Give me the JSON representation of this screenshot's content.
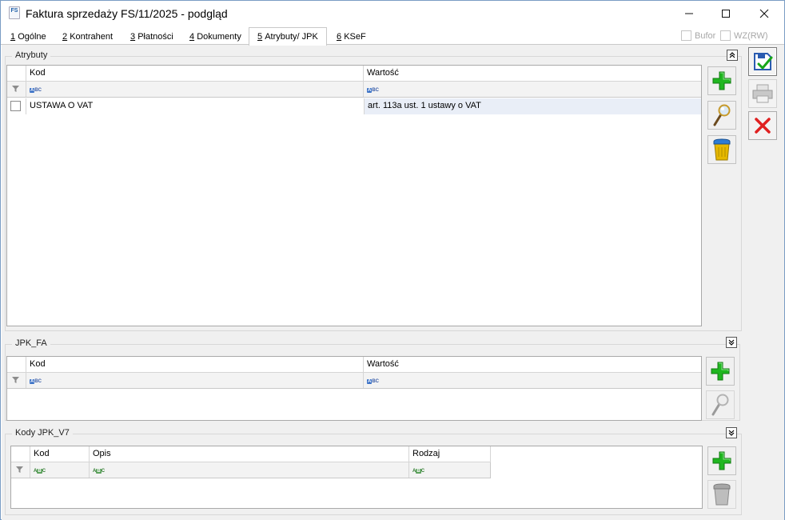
{
  "window": {
    "title": "Faktura sprzedaży FS/11/2025 - podgląd",
    "app_icon_text": "FS"
  },
  "tabs": [
    {
      "key": "1",
      "label": "Ogólne"
    },
    {
      "key": "2",
      "label": "Kontrahent"
    },
    {
      "key": "3",
      "label": "Płatności"
    },
    {
      "key": "4",
      "label": "Dokumenty"
    },
    {
      "key": "5",
      "label": "Atrybuty/ JPK"
    },
    {
      "key": "6",
      "label": "KSeF"
    }
  ],
  "header_checks": {
    "bufor": "Bufor",
    "wz": "WZ(RW)"
  },
  "atrybuty": {
    "legend": "Atrybuty",
    "columns": [
      "Kod",
      "Wartość"
    ],
    "filter_text": "ABC",
    "rows": [
      {
        "kod": "USTAWA O VAT",
        "wartosc": "art. 113a ust. 1 ustawy o VAT"
      }
    ]
  },
  "jpk_fa": {
    "legend": "JPK_FA",
    "columns": [
      "Kod",
      "Wartość"
    ],
    "filter_text": "ABC"
  },
  "kody_jpk_v7": {
    "legend": "Kody JPK_V7",
    "columns": [
      "Kod",
      "Opis",
      "Rodzaj"
    ],
    "filter_text": "ABC"
  },
  "colors": {
    "accent": "#1f5fa8",
    "plus_green": "#22b322",
    "cancel_red": "#e02020"
  }
}
